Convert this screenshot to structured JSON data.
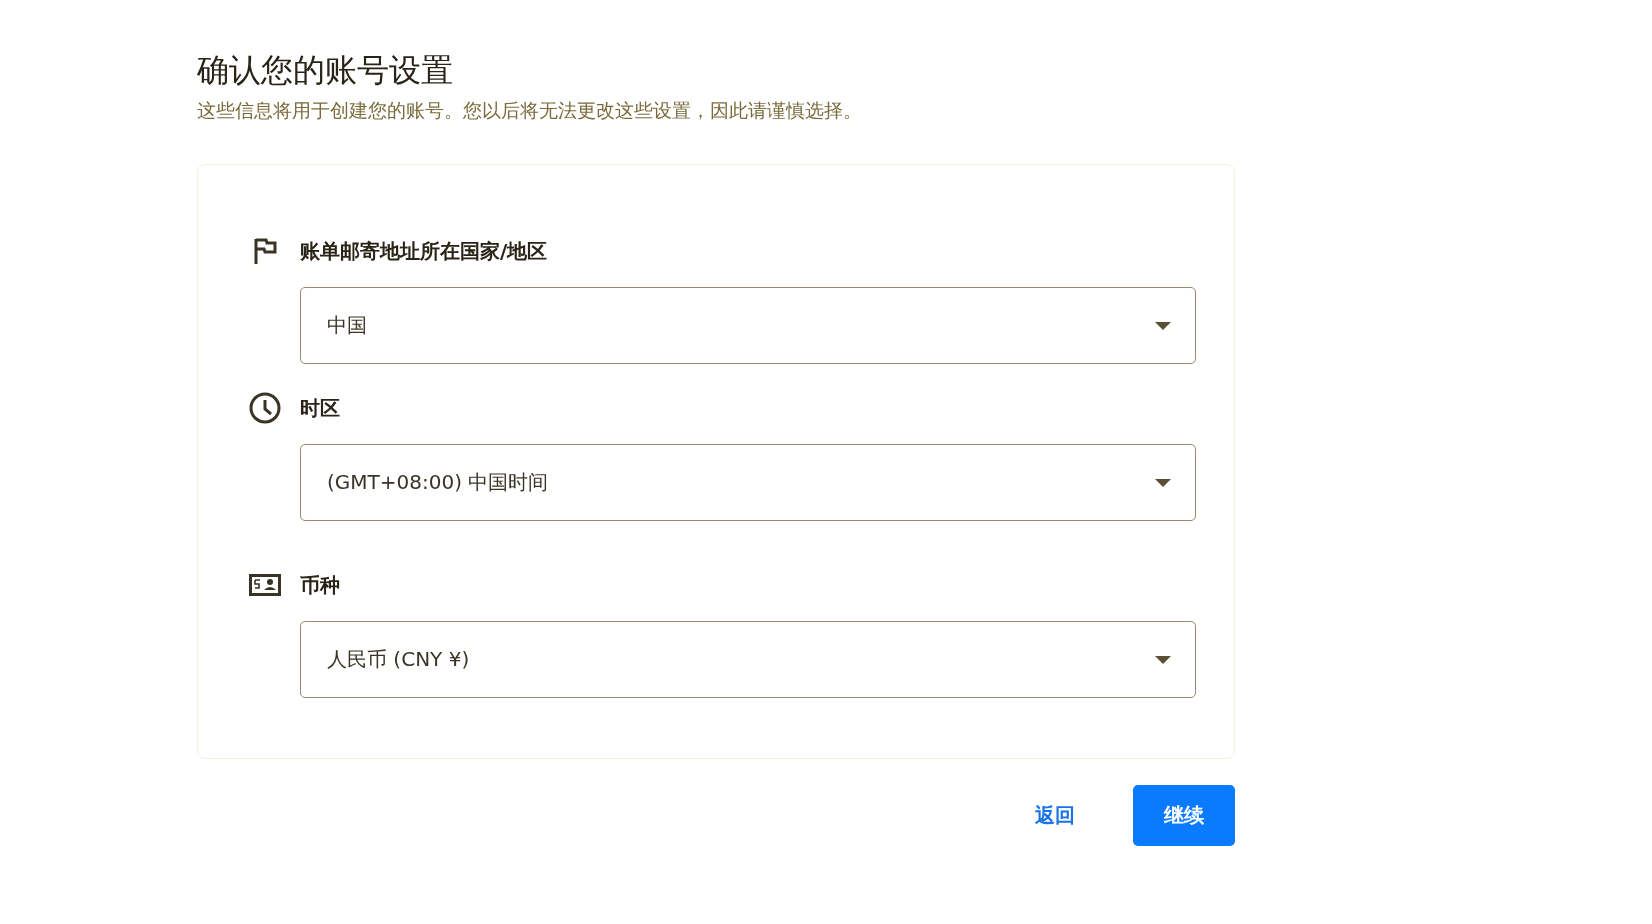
{
  "header": {
    "title": "确认您的账号设置",
    "subtitle": "这些信息将用于创建您的账号。您以后将无法更改这些设置，因此请谨慎选择。"
  },
  "sections": [
    {
      "kind": "country",
      "label": "账单邮寄地址所在国家/地区",
      "value": "中国"
    },
    {
      "kind": "timezone",
      "label": "时区",
      "value": "(GMT+08:00) 中国时间"
    },
    {
      "kind": "currency",
      "label": "币种",
      "value": "人民币 (CNY ¥)"
    }
  ],
  "buttons": [
    {
      "kind": "text",
      "label": "返回"
    },
    {
      "kind": "primary",
      "label": "继续"
    }
  ]
}
